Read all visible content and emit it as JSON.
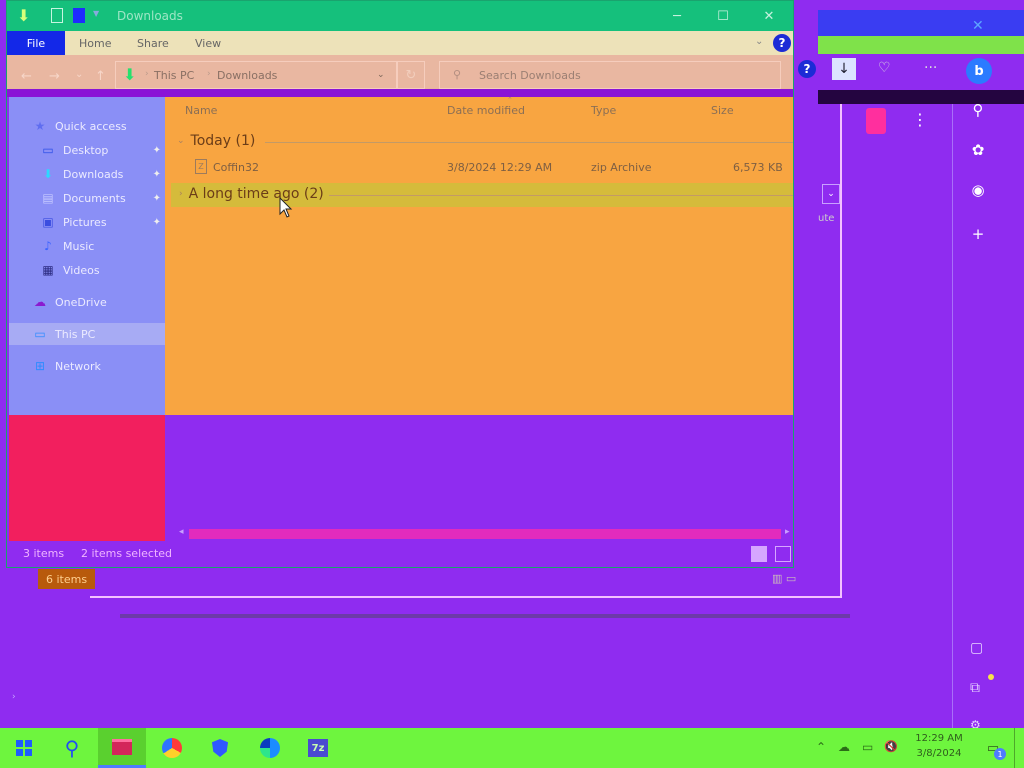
{
  "window": {
    "title": "Downloads",
    "minimize_glyph": "─",
    "maximize_glyph": "☐",
    "close_glyph": "✕"
  },
  "ribbon": {
    "tabs": [
      "File",
      "Home",
      "Share",
      "View"
    ],
    "expand_glyph": "⌄",
    "help_glyph": "?"
  },
  "nav": {
    "back_glyph": "←",
    "forward_glyph": "→",
    "recent_glyph": "⌄",
    "up_glyph": "↑",
    "refresh_glyph": "↻",
    "dropdown_glyph": "⌄"
  },
  "address": {
    "crumbs": [
      "This PC",
      "Downloads"
    ],
    "separator": "›"
  },
  "search": {
    "placeholder": "Search Downloads",
    "icon_glyph": "⚲"
  },
  "navpane": {
    "items": [
      {
        "label": "Quick access",
        "icon": "star-icon",
        "glyph": "★",
        "pinned": false
      },
      {
        "label": "Desktop",
        "icon": "desktop-icon",
        "glyph": "▭",
        "pinned": true
      },
      {
        "label": "Downloads",
        "icon": "download-icon",
        "glyph": "⬇",
        "pinned": true
      },
      {
        "label": "Documents",
        "icon": "documents-icon",
        "glyph": "▤",
        "pinned": true
      },
      {
        "label": "Pictures",
        "icon": "pictures-icon",
        "glyph": "▣",
        "pinned": true
      },
      {
        "label": "Music",
        "icon": "music-icon",
        "glyph": "♪",
        "pinned": false
      },
      {
        "label": "Videos",
        "icon": "videos-icon",
        "glyph": "▦",
        "pinned": false
      },
      {
        "label": "OneDrive",
        "icon": "onedrive-icon",
        "glyph": "☁",
        "pinned": false
      },
      {
        "label": "This PC",
        "icon": "computer-icon",
        "glyph": "▭",
        "pinned": false
      },
      {
        "label": "Network",
        "icon": "network-icon",
        "glyph": "⊞",
        "pinned": false
      }
    ],
    "pin_glyph": "📌"
  },
  "columns": [
    "Name",
    "Date modified",
    "Type",
    "Size"
  ],
  "groups": [
    {
      "label": "Today (1)",
      "chevron": "⌄"
    },
    {
      "label": "A long time ago (2)",
      "chevron": "›"
    }
  ],
  "file": {
    "name": "Coffin32",
    "date_modified": "3/8/2024 12:29 AM",
    "type": "zip Archive",
    "size": "6,573 KB"
  },
  "status": {
    "item_count": "3 items",
    "selection": "2 items selected",
    "background_item_count": "6 items"
  },
  "scroll": {
    "left_glyph": "◂",
    "right_glyph": "▸"
  },
  "background_window": {
    "cut_off_text": "ute",
    "help_glyph": "?",
    "download_glyph": "↓",
    "close_glyph": "✕",
    "kebab_glyph": "⋮",
    "more_glyph": "···",
    "heart_glyph": "♡",
    "bing_glyph": "b",
    "dropdown_glyph": "⌄",
    "sidebar": [
      {
        "name": "search-icon",
        "glyph": "⚲"
      },
      {
        "name": "tools-icon",
        "glyph": "✿"
      },
      {
        "name": "outlook-icon",
        "glyph": "◉"
      },
      {
        "name": "add-icon",
        "glyph": "+"
      }
    ]
  },
  "desktop": {
    "panel_icons": [
      {
        "name": "sidebar-toggle-icon",
        "glyph": "▢"
      },
      {
        "name": "external-link-icon",
        "glyph": "⧉"
      },
      {
        "name": "settings-icon",
        "glyph": "⚙"
      }
    ]
  },
  "taskbar": {
    "tray": {
      "chevron_glyph": "⌃",
      "wifi_glyph": "☁",
      "network_glyph": "▭",
      "volume_glyph": "🔇"
    },
    "clock_time": "12:29 AM",
    "clock_date": "3/8/2024",
    "notification_count": "1",
    "notification_glyph": "▭"
  },
  "colors": {
    "accent": "#1328e8",
    "desktop": "#8f2cf0",
    "taskbar": "#6ef53e",
    "titlebar": "#15c07c"
  }
}
